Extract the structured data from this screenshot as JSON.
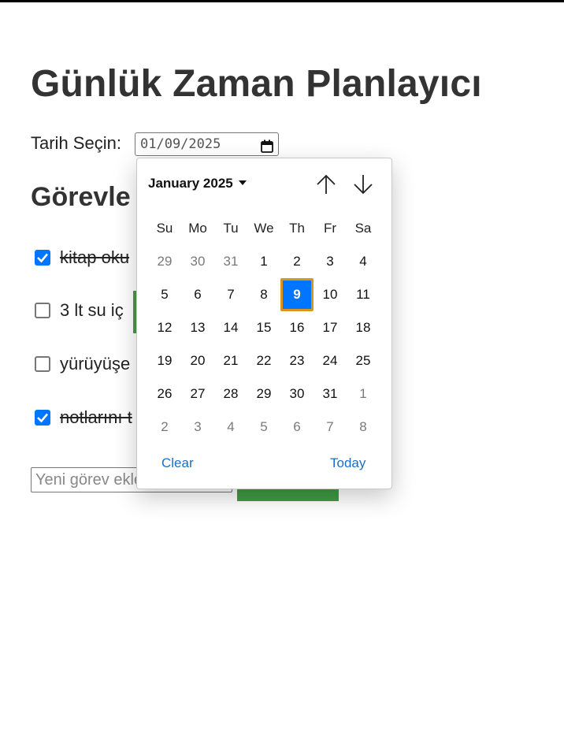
{
  "page": {
    "title": "Günlük Zaman Planlayıcı",
    "date_label": "Tarih Seçin:",
    "date_value": "01/09/2025",
    "tasks_heading": "Görevle",
    "new_task_placeholder": "Yeni görev ekle"
  },
  "tasks": [
    {
      "text": "kitap oku",
      "checked": true
    },
    {
      "text": "3 lt su iç",
      "checked": false
    },
    {
      "text": "yürüyüşe",
      "checked": false
    },
    {
      "text": "notlarını t",
      "checked": true
    }
  ],
  "calendar": {
    "month_label": "January 2025",
    "weekdays": [
      "Su",
      "Mo",
      "Tu",
      "We",
      "Th",
      "Fr",
      "Sa"
    ],
    "weeks": [
      [
        "29",
        "30",
        "31",
        "1",
        "2",
        "3",
        "4"
      ],
      [
        "5",
        "6",
        "7",
        "8",
        "9",
        "10",
        "11"
      ],
      [
        "12",
        "13",
        "14",
        "15",
        "16",
        "17",
        "18"
      ],
      [
        "19",
        "20",
        "21",
        "22",
        "23",
        "24",
        "25"
      ],
      [
        "26",
        "27",
        "28",
        "29",
        "30",
        "31",
        "1"
      ],
      [
        "2",
        "3",
        "4",
        "5",
        "6",
        "7",
        "8"
      ]
    ],
    "selected_day": "9",
    "clear_label": "Clear",
    "today_label": "Today"
  },
  "colors": {
    "accent": "#0075ff",
    "focus_ring": "#d9961c",
    "link": "#1a6fc4",
    "button_green": "#3f9b46"
  }
}
